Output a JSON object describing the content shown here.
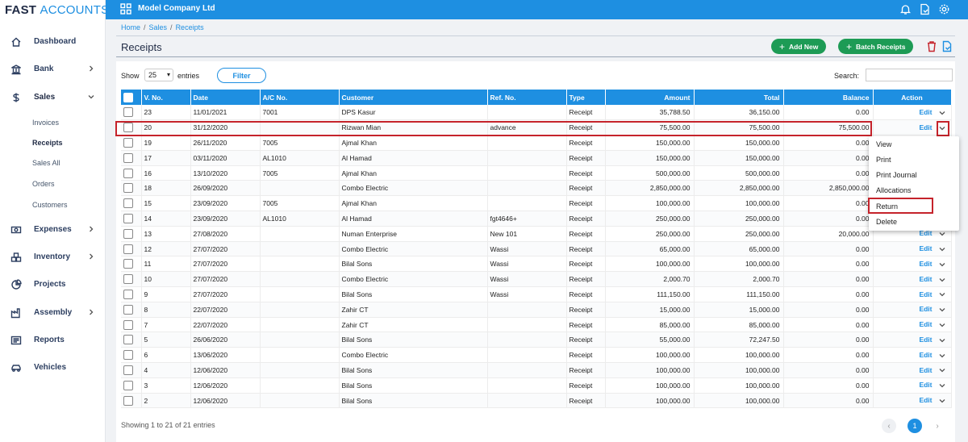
{
  "app": {
    "logo_part1": "FAST",
    "logo_part2": "ACCOUNTS",
    "company": "Model Company Ltd"
  },
  "sidebar": {
    "items": [
      {
        "label": "Dashboard",
        "icon": "home-icon"
      },
      {
        "label": "Bank",
        "icon": "bank-icon"
      },
      {
        "label": "Sales",
        "icon": "dollar-icon"
      },
      {
        "label": "Expenses",
        "icon": "money-icon"
      },
      {
        "label": "Inventory",
        "icon": "boxes-icon"
      },
      {
        "label": "Projects",
        "icon": "pie-icon"
      },
      {
        "label": "Assembly",
        "icon": "factory-icon"
      },
      {
        "label": "Reports",
        "icon": "report-icon"
      },
      {
        "label": "Vehicles",
        "icon": "car-icon"
      }
    ],
    "sales_sub": [
      "Invoices",
      "Receipts",
      "Sales All",
      "Orders",
      "Customers"
    ]
  },
  "breadcrumb": [
    "Home",
    "Sales",
    "Receipts"
  ],
  "page_title": "Receipts",
  "buttons": {
    "add_new": "Add New",
    "batch_receipts": "Batch Receipts",
    "filter": "Filter"
  },
  "controls": {
    "show": "Show",
    "entries_value": "25",
    "entries": "entries",
    "search": "Search:"
  },
  "table": {
    "headers": [
      "V. No.",
      "Date",
      "A/C No.",
      "Customer",
      "Ref. No.",
      "Type",
      "Amount",
      "Total",
      "Balance",
      "Action"
    ],
    "edit_label": "Edit",
    "rows": [
      [
        "23",
        "11/01/2021",
        "7001",
        "DPS Kasur",
        "",
        "Receipt",
        "35,788.50",
        "36,150.00",
        "0.00"
      ],
      [
        "20",
        "31/12/2020",
        "",
        "Rizwan Mian",
        "advance",
        "Receipt",
        "75,500.00",
        "75,500.00",
        "75,500.00"
      ],
      [
        "19",
        "26/11/2020",
        "7005",
        "Ajmal Khan",
        "",
        "Receipt",
        "150,000.00",
        "150,000.00",
        "0.00"
      ],
      [
        "17",
        "03/11/2020",
        "AL1010",
        "Al Hamad",
        "",
        "Receipt",
        "150,000.00",
        "150,000.00",
        "0.00"
      ],
      [
        "16",
        "13/10/2020",
        "7005",
        "Ajmal Khan",
        "",
        "Receipt",
        "500,000.00",
        "500,000.00",
        "0.00"
      ],
      [
        "18",
        "26/09/2020",
        "",
        "Combo Electric",
        "",
        "Receipt",
        "2,850,000.00",
        "2,850,000.00",
        "2,850,000.00"
      ],
      [
        "15",
        "23/09/2020",
        "7005",
        "Ajmal Khan",
        "",
        "Receipt",
        "100,000.00",
        "100,000.00",
        "0.00"
      ],
      [
        "14",
        "23/09/2020",
        "AL1010",
        "Al Hamad",
        "fgt4646+",
        "Receipt",
        "250,000.00",
        "250,000.00",
        "0.00"
      ],
      [
        "13",
        "27/08/2020",
        "",
        "Numan Enterprise",
        "New 101",
        "Receipt",
        "250,000.00",
        "250,000.00",
        "20,000.00"
      ],
      [
        "12",
        "27/07/2020",
        "",
        "Combo Electric",
        "Wassi",
        "Receipt",
        "65,000.00",
        "65,000.00",
        "0.00"
      ],
      [
        "11",
        "27/07/2020",
        "",
        "Bilal Sons",
        "Wassi",
        "Receipt",
        "100,000.00",
        "100,000.00",
        "0.00"
      ],
      [
        "10",
        "27/07/2020",
        "",
        "Combo Electric",
        "Wassi",
        "Receipt",
        "2,000.70",
        "2,000.70",
        "0.00"
      ],
      [
        "9",
        "27/07/2020",
        "",
        "Bilal Sons",
        "Wassi",
        "Receipt",
        "111,150.00",
        "111,150.00",
        "0.00"
      ],
      [
        "8",
        "22/07/2020",
        "",
        "Zahir CT",
        "",
        "Receipt",
        "15,000.00",
        "15,000.00",
        "0.00"
      ],
      [
        "7",
        "22/07/2020",
        "",
        "Zahir CT",
        "",
        "Receipt",
        "85,000.00",
        "85,000.00",
        "0.00"
      ],
      [
        "5",
        "26/06/2020",
        "",
        "Bilal Sons",
        "",
        "Receipt",
        "55,000.00",
        "72,247.50",
        "0.00"
      ],
      [
        "6",
        "13/06/2020",
        "",
        "Combo Electric",
        "",
        "Receipt",
        "100,000.00",
        "100,000.00",
        "0.00"
      ],
      [
        "4",
        "12/06/2020",
        "",
        "Bilal Sons",
        "",
        "Receipt",
        "100,000.00",
        "100,000.00",
        "0.00"
      ],
      [
        "3",
        "12/06/2020",
        "",
        "Bilal Sons",
        "",
        "Receipt",
        "100,000.00",
        "100,000.00",
        "0.00"
      ],
      [
        "2",
        "12/06/2020",
        "",
        "Bilal Sons",
        "",
        "Receipt",
        "100,000.00",
        "100,000.00",
        "0.00"
      ]
    ]
  },
  "dropdown_menu": [
    "View",
    "Print",
    "Print Journal",
    "Allocations",
    "Return",
    "Delete"
  ],
  "footer": {
    "showing": "Showing 1 to 21 of 21 entries",
    "current_page": "1"
  },
  "colors": {
    "primary": "#1e8fe1",
    "green": "#1d9b55",
    "highlight": "#c5232b"
  }
}
